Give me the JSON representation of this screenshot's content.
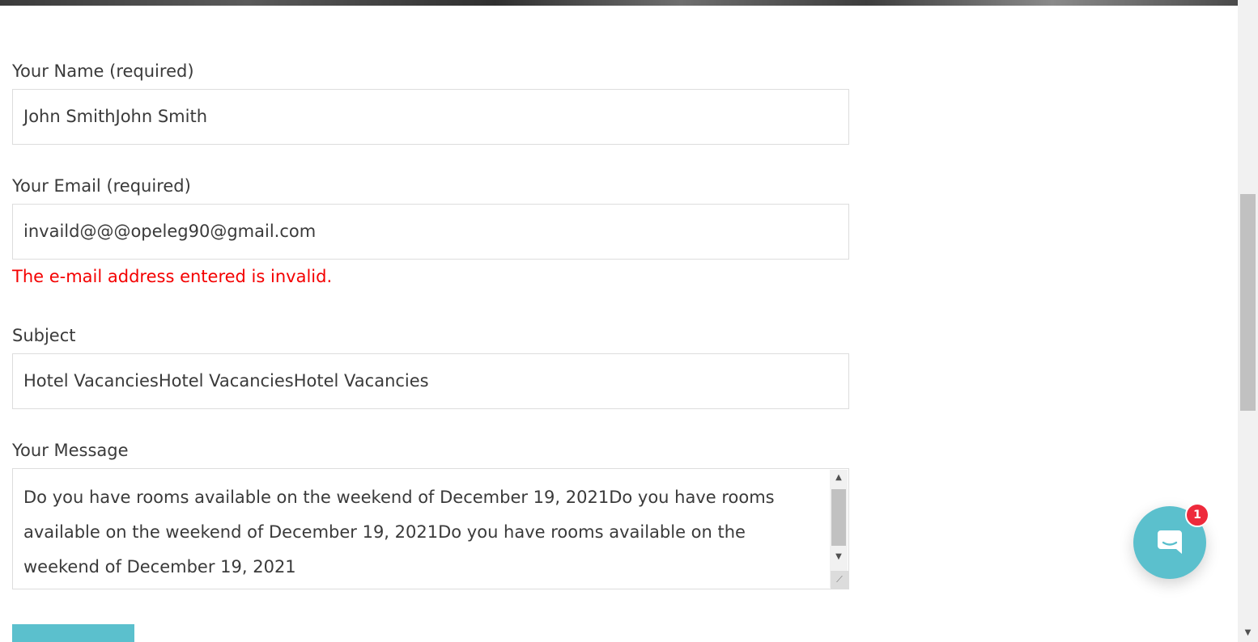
{
  "form": {
    "name_label": "Your Name (required)",
    "name_value": "John SmithJohn Smith",
    "email_label": "Your Email (required)",
    "email_value": "invaild@@@opeleg90@gmail.com",
    "email_error": "The e-mail address entered is invalid.",
    "subject_label": "Subject",
    "subject_value": "Hotel VacanciesHotel VacanciesHotel Vacancies",
    "message_label": "Your Message",
    "message_value": "Do you have rooms available on the weekend of  December 19, 2021Do you have rooms available on the weekend of  December 19, 2021Do you have rooms available on the weekend of  December 19, 2021"
  },
  "chat": {
    "badge_count": "1",
    "icon": "chat-bubble-icon",
    "color": "#5bc0cd",
    "badge_color": "#ee2a3c"
  },
  "colors": {
    "error": "#f40000",
    "accent": "#5bc0cd"
  }
}
